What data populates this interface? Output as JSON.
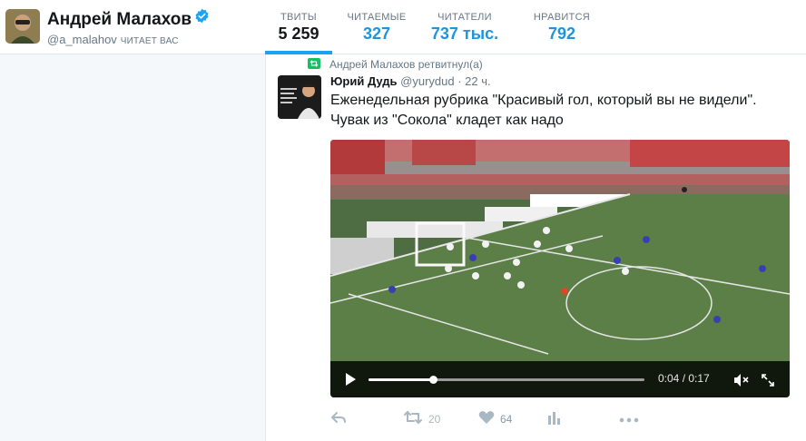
{
  "profile": {
    "name": "Андрей Малахов",
    "handle": "@a_malahov",
    "follows_you": "ЧИТАЕТ ВАС",
    "verified": true
  },
  "nav": [
    {
      "label": "ТВИТЫ",
      "value": "5 259",
      "active": true
    },
    {
      "label": "ЧИТАЕМЫЕ",
      "value": "327",
      "active": false
    },
    {
      "label": "ЧИТАТЕЛИ",
      "value": "737 тыс.",
      "active": false
    },
    {
      "label": "НРАВИТСЯ",
      "value": "792",
      "active": false
    }
  ],
  "tweet": {
    "retweet_context": "Андрей Малахов ретвитнул(а)",
    "author_name": "Юрий Дудь",
    "author_handle": "@yurydud",
    "time": "· 22 ч.",
    "text": "Еженедельная рубрика \"Красивый гол, который вы не видели\". Чувак из \"Сокола\" кладет как надо",
    "video": {
      "time": "0:04 / 0:17",
      "progress": 0.235
    },
    "actions": {
      "retweets": "20",
      "likes": "64"
    }
  },
  "colors": {
    "accent": "#1da1f2",
    "link": "#1b95e0",
    "retweet_green": "#17bf63",
    "verified": "#1da1f2"
  },
  "icons": {
    "verified": "verified-badge-icon",
    "retweet_small": "retweet-icon",
    "reply": "reply-icon",
    "retweet": "retweet-icon",
    "like": "heart-icon",
    "analytics": "bar-chart-icon",
    "more": "more-dots-icon",
    "play": "play-icon",
    "mute": "mute-icon",
    "fullscreen": "fullscreen-icon"
  }
}
